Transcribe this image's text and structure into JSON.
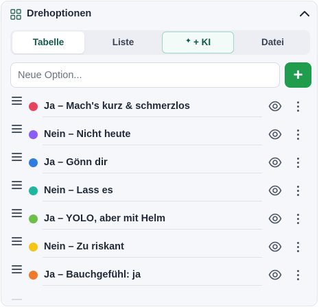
{
  "header": {
    "title": "Drehoptionen",
    "icon": "grid-icon",
    "collapse_icon": "chevron-up-icon"
  },
  "tabs": [
    {
      "label": "Tabelle",
      "active": true
    },
    {
      "label": "Liste",
      "active": false
    },
    {
      "label": "+ KI",
      "active": false,
      "icon": "sparkle-icon"
    },
    {
      "label": "Datei",
      "active": false
    }
  ],
  "new_option": {
    "placeholder": "Neue Option...",
    "value": "",
    "add_label": "+"
  },
  "options": [
    {
      "label": "Ja – Mach's kurz & schmerzlos",
      "color": "#e8435a"
    },
    {
      "label": "Nein – Nicht heute",
      "color": "#8b5cf6"
    },
    {
      "label": "Ja – Gönn dir",
      "color": "#2f7de1"
    },
    {
      "label": "Nein – Lass es",
      "color": "#1fb6a0"
    },
    {
      "label": "Ja – YOLO, aber mit Helm",
      "color": "#6cc04a"
    },
    {
      "label": "Nein – Zu riskant",
      "color": "#f5c518"
    },
    {
      "label": "Ja – Bauchgefühl: ja",
      "color": "#f07a2a"
    }
  ],
  "colors": {
    "accent": "#1f9d4c",
    "tab_active_text": "#0f5a47"
  }
}
